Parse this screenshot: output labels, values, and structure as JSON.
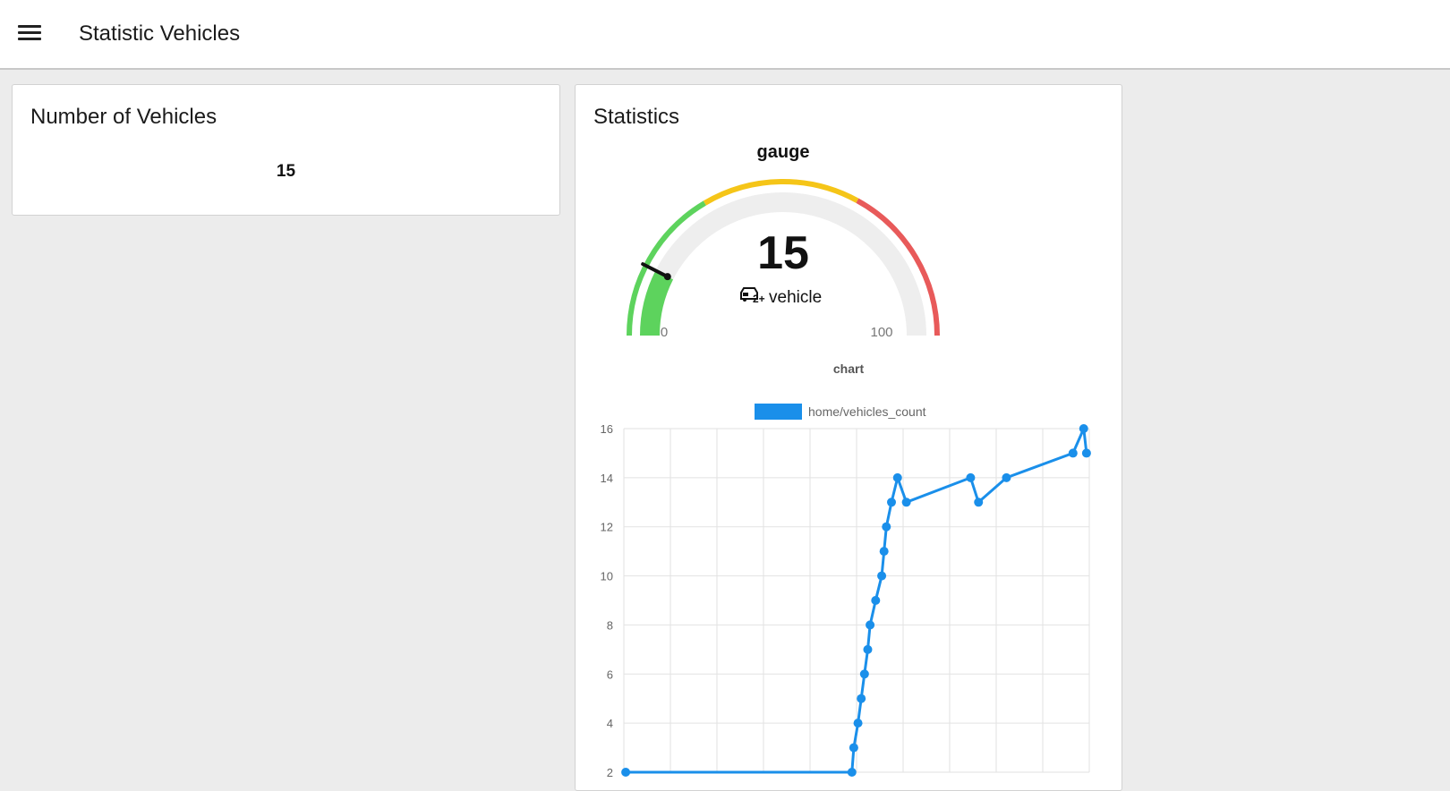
{
  "header": {
    "title": "Statistic Vehicles",
    "menu_icon": "hamburger-menu-icon"
  },
  "number_card": {
    "title": "Number of Vehicles",
    "value": "15"
  },
  "statistics_card": {
    "title": "Statistics",
    "gauge": {
      "title": "gauge",
      "value": 15,
      "value_text": "15",
      "unit": "vehicle",
      "unit_icon": "vehicle-icon",
      "min": 0,
      "max": 100,
      "min_label": "0",
      "max_label": "100",
      "bands": [
        {
          "from": 0,
          "to": 33,
          "color": "#5dd35d"
        },
        {
          "from": 33,
          "to": 66,
          "color": "#f5c518"
        },
        {
          "from": 66,
          "to": 100,
          "color": "#e85a5a"
        }
      ],
      "track_color": "#eeeeee"
    },
    "chart_title": "chart"
  },
  "chart_data": {
    "type": "line",
    "title": "chart",
    "xlabel": "",
    "ylabel": "",
    "ylim": [
      2,
      16
    ],
    "yticks": [
      "16",
      "14",
      "12",
      "10",
      "8",
      "6",
      "4",
      "2"
    ],
    "grid": true,
    "legend_position": "top",
    "series": [
      {
        "name": "home/vehicles_count",
        "color": "#1a8fea",
        "values": [
          2,
          2,
          3,
          4,
          5,
          6,
          7,
          8,
          9,
          10,
          11,
          12,
          13,
          14,
          13,
          14,
          13,
          14,
          15,
          16,
          15
        ]
      }
    ]
  }
}
